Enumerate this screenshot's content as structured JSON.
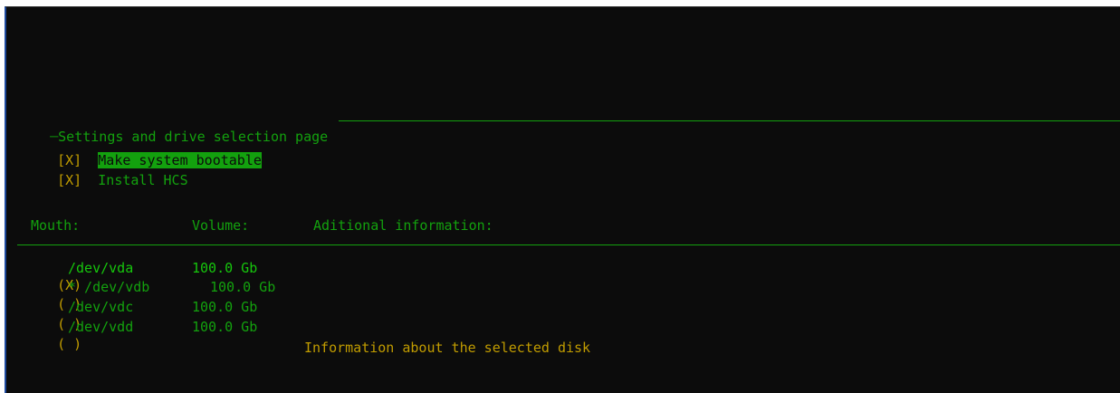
{
  "page": {
    "title": "Settings and drive selection page"
  },
  "options": [
    {
      "mark": "[X]",
      "label": "Make system bootable",
      "selected": true
    },
    {
      "mark": "[X]",
      "label": "Install HCS",
      "selected": false
    }
  ],
  "columns": {
    "mouth": "Mouth:",
    "volume": "Volume:",
    "info": "Aditional information:"
  },
  "disks": [
    {
      "mark": "(X)",
      "mount": "/dev/vda",
      "volume": "100.0 Gb"
    },
    {
      "mark": "( )",
      "mount": "* /dev/vdb",
      "volume": "100.0 Gb"
    },
    {
      "mark": "( )",
      "mount": "/dev/vdc",
      "volume": "100.0 Gb"
    },
    {
      "mark": "( )",
      "mount": "/dev/vdd",
      "volume": "100.0 Gb"
    }
  ],
  "info_text": "Information about the selected disk",
  "colors": {
    "background": "#0c0c0c",
    "green": "#13a10e",
    "yellow": "#c19c00"
  }
}
